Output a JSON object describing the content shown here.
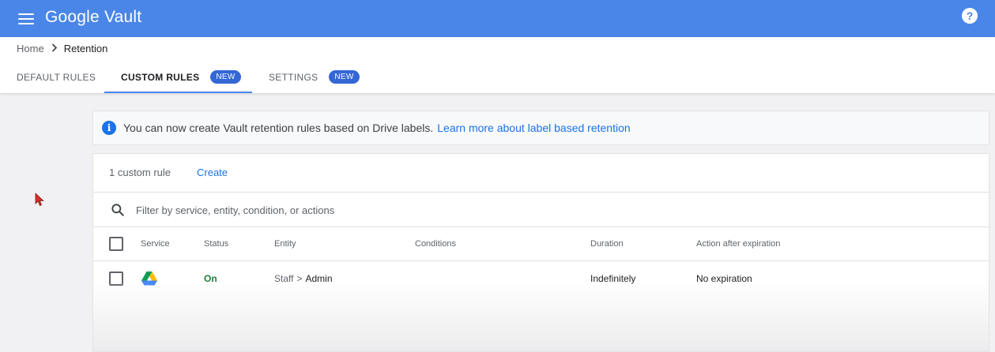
{
  "app": {
    "title": "Google Vault"
  },
  "breadcrumb": {
    "home": "Home",
    "current": "Retention"
  },
  "tabs": [
    {
      "label": "DEFAULT RULES",
      "badge": ""
    },
    {
      "label": "CUSTOM RULES",
      "badge": "NEW"
    },
    {
      "label": "SETTINGS",
      "badge": "NEW"
    }
  ],
  "banner": {
    "text": "You can now create Vault retention rules based on Drive labels.",
    "link": "Learn more about label based retention"
  },
  "rules": {
    "count_label": "1 custom rule",
    "create_label": "Create",
    "filter_placeholder": "Filter by service, entity, condition, or actions",
    "columns": {
      "service": "Service",
      "status": "Status",
      "entity": "Entity",
      "conditions": "Conditions",
      "duration": "Duration",
      "action": "Action after expiration"
    },
    "rows": [
      {
        "service_icon": "google-drive-icon",
        "status": "On",
        "entity_parent": "Staff",
        "entity_sep": ">",
        "entity_child": "Admin",
        "conditions": "",
        "duration": "Indefinitely",
        "action": "No expiration"
      }
    ]
  },
  "colors": {
    "appbar": "#4a86e8",
    "badge": "#3367d6",
    "link": "#1a73e8",
    "status_on": "#188038"
  }
}
